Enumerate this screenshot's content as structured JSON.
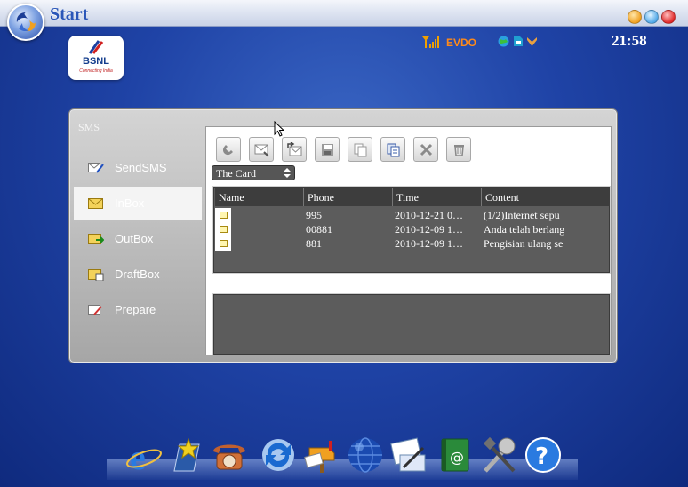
{
  "window": {
    "title": "Start"
  },
  "status": {
    "network": "EVDO",
    "clock": "21:58"
  },
  "logo": {
    "name": "BSNL",
    "tagline": "Connecting India"
  },
  "sms": {
    "title": "SMS",
    "menu": [
      {
        "label": "SendSMS",
        "icon": "send-sms-icon"
      },
      {
        "label": "InBox",
        "icon": "inbox-envelope-icon",
        "active": true
      },
      {
        "label": "OutBox",
        "icon": "outbox-icon"
      },
      {
        "label": "DraftBox",
        "icon": "draftbox-icon"
      },
      {
        "label": "Prepare",
        "icon": "prepare-icon"
      }
    ],
    "toolbar": [
      "call-icon",
      "reply-icon",
      "forward-icon",
      "save-icon",
      "copy-icon",
      "paste-icon",
      "delete-icon",
      "trash-icon"
    ],
    "storage": {
      "selected": "The Card"
    },
    "columns": [
      "Name",
      "Phone",
      "Time",
      "Content"
    ],
    "messages": [
      {
        "name": "",
        "phone": "995",
        "time": "2010-12-21 0…",
        "content": "(1/2)Internet sepu"
      },
      {
        "name": "",
        "phone": "00881",
        "time": "2010-12-09 1…",
        "content": "Anda telah berlang"
      },
      {
        "name": "",
        "phone": "881",
        "time": "2010-12-09 1…",
        "content": "Pengisian ulang se"
      }
    ]
  },
  "dock": [
    "internet-explorer-icon",
    "favorites-icon",
    "phone-icon",
    "sync-icon",
    "mailbox-icon",
    "globe-icon",
    "notes-icon",
    "email-book-icon",
    "tools-icon",
    "help-icon"
  ],
  "colors": {
    "accent": "#2a56b8",
    "desktop": "#1f43a6",
    "network": "#ff8a1a"
  }
}
